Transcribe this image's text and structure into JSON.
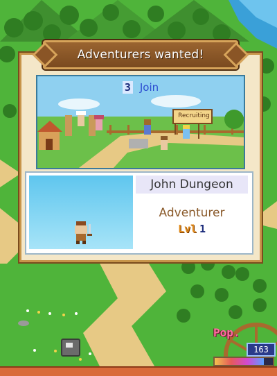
{
  "dialog": {
    "title": "Adventurers wanted!",
    "join_count": "3",
    "join_label": "Join",
    "sign_text": "Recruiting"
  },
  "adventurer": {
    "name": "John Dungeon",
    "class": "Adventurer",
    "level_label": "Lvl",
    "level": "1"
  },
  "hud": {
    "pop_label": "Pop.",
    "population": "163",
    "pop_bar_fraction": 0.85
  },
  "colors": {
    "grass": "#4fb43a",
    "path": "#e7c985",
    "panel": "#f4e7c8",
    "frame": "#c7954a"
  }
}
